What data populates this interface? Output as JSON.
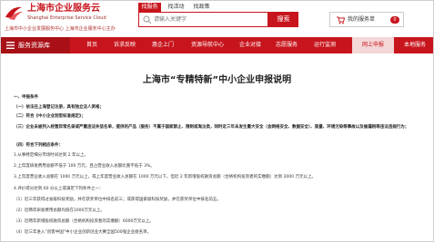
{
  "brand": {
    "title": "上海市企业服务云",
    "subtitle": "Shanghai Enterprise Service Cloud",
    "slogan": "上海市中小企业发展服务中心  上海市企业服务中心主办"
  },
  "search": {
    "tabs": [
      "找服务",
      "找活动",
      "找政策"
    ],
    "active_tab": 0,
    "placeholder": "请输入关键字",
    "button": "搜索"
  },
  "cart": {
    "label": "我的服务单",
    "count": "0"
  },
  "nav": {
    "home": "服务资源库",
    "items": [
      "首页",
      "诉求反映",
      "惠企上门",
      "资源导航中心",
      "企业对接",
      "志愿服务",
      "运行监测",
      "网上申报",
      "本地服务"
    ],
    "active_index": 7
  },
  "document": {
    "title": "上海市“专精特新”中小企业申报说明",
    "lines": [
      {
        "text": "一、申报条件",
        "bold": true
      },
      {
        "text": "（一）依法在上海登记注册，具有独立法人资格；",
        "bold": true
      },
      {
        "text": "（二）符合《中小企业划型标准规定》；",
        "bold": true
      },
      {
        "text": "（三）企业未被列入经营异常名录或严重违法失信名单，提供的产品（服务）不属于国家禁止、限制或淘汰类，同时近三年未发生重大安全（含网络安全、数据安全）、质量、环境污染等事故以及偷漏税等违法违规行为；",
        "bold": true
      },
      {
        "text": "（四）符合下列相应条件：",
        "bold": true
      },
      {
        "text": "1.从事特定细分市场时间达到 2 年以上。",
        "bold": false
      },
      {
        "text": "2.上年度研发费用总额不低于 100 万元，且占营业收入总额比重不低于 3%。",
        "bold": false
      },
      {
        "text": "3.上年度营业收入总额在 1000 万元以上，或上年度营业收入总额在 1000 万元以下，但近 2 年新增股权融资总额（合格机构投资者的实缴额）达到 2000 万元以上。",
        "bold": false
      },
      {
        "text": "4.评价得分达到 60 分以上或满足下列条件之一：",
        "bold": false
      },
      {
        "text": "（1）近三年获得过省级科技奖励，并在获奖单位中排名前三；或获得国家级科技奖励，并在获奖单位中排名前五。",
        "bold": false
      },
      {
        "text": "（2）近两年研发费用总额均值在1000万元以上。",
        "bold": false
      },
      {
        "text": "（3）近两年新增股权融资总额（合格机构投资者的实缴额）6000万元以上。",
        "bold": false
      },
      {
        "text": "（4）近三年进入“创客中国”中小企业创新创业大赛全国500强企业组名单。",
        "bold": false
      }
    ]
  },
  "colors": {
    "brand_red": "#c8151d",
    "nav_home_bg": "#a80f16",
    "nav_active_bg": "#f4d7d7"
  }
}
